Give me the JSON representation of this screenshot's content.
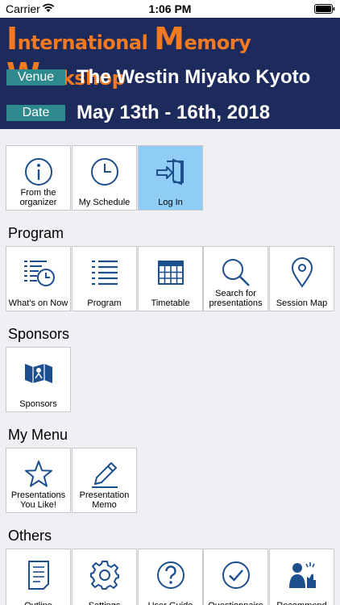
{
  "status_bar": {
    "carrier": "Carrier",
    "time": "1:06 PM"
  },
  "banner": {
    "title_parts": [
      "I",
      "nternational ",
      "M",
      "emory ",
      "W",
      "orkshop"
    ],
    "venue_tag": "Venue",
    "venue": "The Westin Miyako Kyoto",
    "date_tag": "Date",
    "date": "May 13th - 16th, 2018"
  },
  "top_tiles": [
    {
      "label": "From the organizer",
      "icon": "info-icon"
    },
    {
      "label": "My Schedule",
      "icon": "clock-icon"
    },
    {
      "label": "Log In",
      "icon": "login-icon",
      "active": true
    }
  ],
  "sections": {
    "program": {
      "title": "Program",
      "tiles": [
        {
          "label": "What's on Now",
          "icon": "list-clock-icon"
        },
        {
          "label": "Program",
          "icon": "list-icon"
        },
        {
          "label": "Timetable",
          "icon": "calendar-icon"
        },
        {
          "label": "Search for presentations",
          "icon": "search-icon"
        },
        {
          "label": "Session Map",
          "icon": "map-pin-icon"
        }
      ]
    },
    "sponsors": {
      "title": "Sponsors",
      "tiles": [
        {
          "label": "Sponsors",
          "icon": "sponsor-icon"
        }
      ]
    },
    "my_menu": {
      "title": "My Menu",
      "tiles": [
        {
          "label": "Presentations You Like!",
          "icon": "star-icon"
        },
        {
          "label": "Presentation Memo",
          "icon": "pencil-icon"
        }
      ]
    },
    "others": {
      "title": "Others",
      "tiles": [
        {
          "label": "Outline",
          "icon": "document-icon"
        },
        {
          "label": "Settings",
          "icon": "gear-icon"
        },
        {
          "label": "User Guide",
          "icon": "question-icon"
        },
        {
          "label": "Questionnaire",
          "icon": "check-icon"
        },
        {
          "label": "Recommend",
          "icon": "thumbs-up-icon"
        }
      ]
    }
  },
  "colors": {
    "banner_bg": "#1c2a5c",
    "title_orange": "#f47a20",
    "tag_teal": "#2f8a8e",
    "icon_blue": "#1d4f8c",
    "active_tile": "#8fcdf7"
  }
}
